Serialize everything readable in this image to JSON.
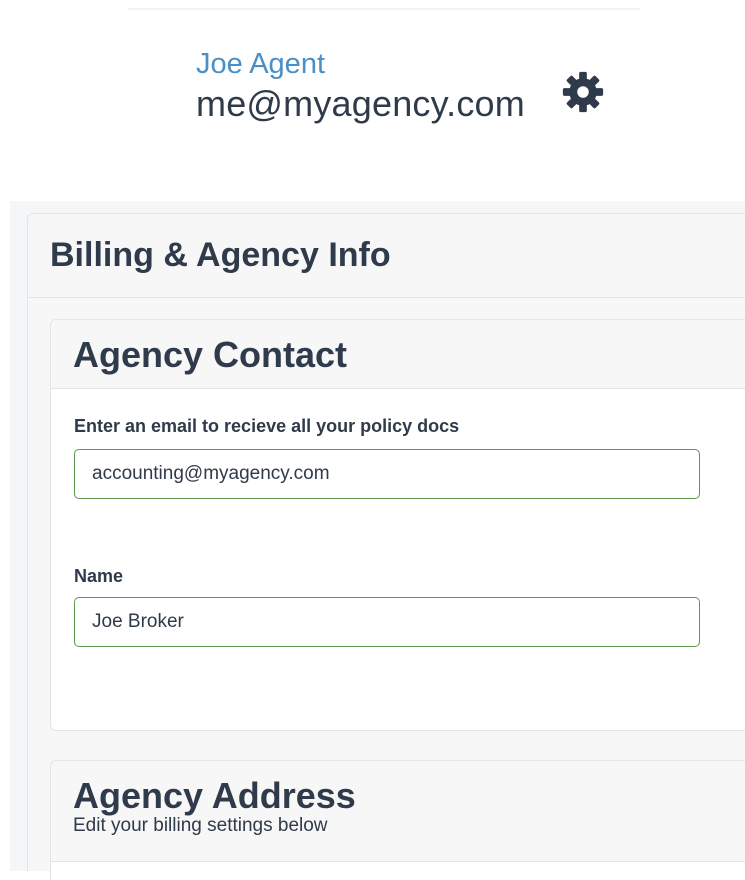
{
  "user": {
    "name": "Joe Agent",
    "email": "me@myagency.com",
    "settings_icon": "gear-icon"
  },
  "billing": {
    "title": "Billing & Agency Info"
  },
  "contact": {
    "title": "Agency Contact",
    "email_label": "Enter an email to recieve all your policy docs",
    "email_value": "accounting@myagency.com",
    "name_label": "Name",
    "name_value": "Joe Broker"
  },
  "address": {
    "title": "Agency Address",
    "subtitle": "Edit your billing settings below"
  },
  "colors": {
    "accent_link": "#4a90c8",
    "input_border": "#5b9a4e",
    "text": "#2f3a4a"
  }
}
